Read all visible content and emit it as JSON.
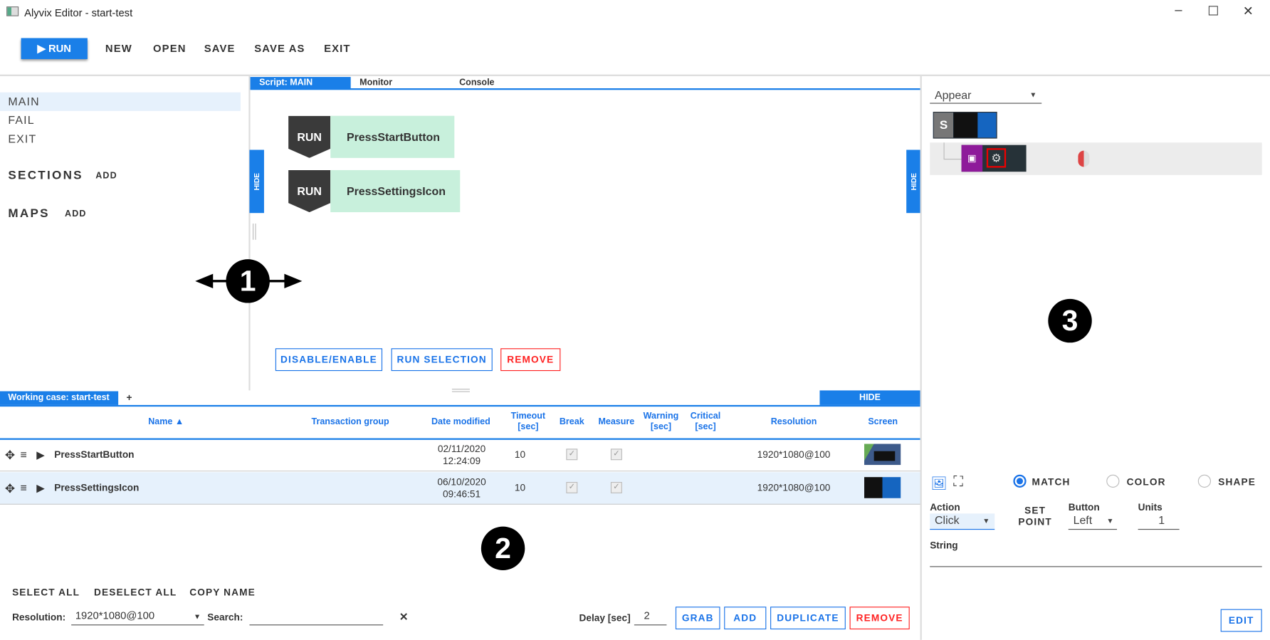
{
  "window": {
    "title": "Alyvix Editor - start-test",
    "controls": [
      "–",
      "☐",
      "✕"
    ]
  },
  "toolbar": {
    "run": "RUN",
    "new": "NEW",
    "open": "OPEN",
    "save": "SAVE",
    "save_as": "SAVE AS",
    "exit": "EXIT"
  },
  "left": {
    "items": [
      "MAIN",
      "FAIL",
      "EXIT"
    ],
    "sections": "SECTIONS",
    "maps": "MAPS",
    "add": "ADD"
  },
  "script": {
    "tabs": [
      "Script: MAIN",
      "Monitor",
      "Console"
    ],
    "hide": "HIDE",
    "steps": [
      {
        "kind": "RUN",
        "name": "PressStartButton"
      },
      {
        "kind": "RUN",
        "name": "PressSettingsIcon"
      }
    ],
    "buttons": {
      "disable_enable": "DISABLE/ENABLE",
      "run_selection": "RUN SELECTION",
      "remove": "REMOVE"
    }
  },
  "callouts": [
    "1",
    "2",
    "3"
  ],
  "cases": {
    "tab": "Working case: start-test",
    "add_tab": "+",
    "hide": "HIDE",
    "columns": [
      "Name ▲",
      "Transaction group",
      "Date modified",
      "Timeout [sec]",
      "Break",
      "Measure",
      "Warning [sec]",
      "Critical [sec]",
      "Resolution",
      "Screen"
    ],
    "rows": [
      {
        "name": "PressStartButton",
        "transaction_group": "",
        "date": "02/11/2020",
        "time": "12:24:09",
        "timeout": "10",
        "break": true,
        "measure": true,
        "warning": "",
        "critical": "",
        "resolution": "1920*1080@100",
        "selected": false
      },
      {
        "name": "PressSettingsIcon",
        "transaction_group": "",
        "date": "06/10/2020",
        "time": "09:46:51",
        "timeout": "10",
        "break": true,
        "measure": true,
        "warning": "",
        "critical": "",
        "resolution": "1920*1080@100",
        "selected": true
      }
    ],
    "select_all": "SELECT ALL",
    "deselect_all": "DESELECT ALL",
    "copy_name": "COPY NAME",
    "resolution_label": "Resolution:",
    "resolution_value": "1920*1080@100",
    "search_label": "Search:",
    "search_value": "",
    "clear": "✕",
    "delay_label": "Delay [sec]",
    "delay_value": "2",
    "grab": "GRAB",
    "add": "ADD",
    "duplicate": "DUPLICATE",
    "remove": "REMOVE"
  },
  "designer": {
    "mode": "Appear",
    "node_label": "S",
    "match": "MATCH",
    "color": "COLOR",
    "shape": "SHAPE",
    "selected_mode": "MATCH",
    "action_label": "Action",
    "action_value": "Click",
    "set_point": "SET POINT",
    "button_label": "Button",
    "button_value": "Left",
    "units_label": "Units",
    "units_value": "1",
    "string_label": "String",
    "string_value": "",
    "edit": "EDIT"
  },
  "colors": {
    "accent": "#1a7fe8",
    "danger": "#ff2222",
    "step_bg": "#c8f0dc",
    "step_kind_bg": "#3a3a3a",
    "selected_row": "#e6f1fc"
  }
}
